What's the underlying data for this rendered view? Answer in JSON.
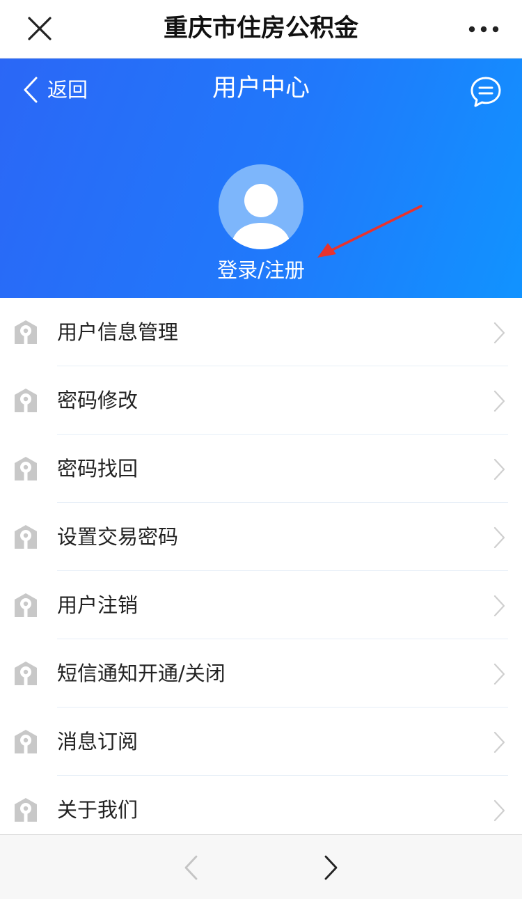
{
  "window": {
    "title": "重庆市住房公积金"
  },
  "header": {
    "back_label": "返回",
    "title": "用户中心"
  },
  "profile": {
    "login_label": "登录/注册"
  },
  "menu": {
    "items": [
      {
        "label": "用户信息管理"
      },
      {
        "label": "密码修改"
      },
      {
        "label": "密码找回"
      },
      {
        "label": "设置交易密码"
      },
      {
        "label": "用户注销"
      },
      {
        "label": "短信通知开通/关闭"
      },
      {
        "label": "消息订阅"
      },
      {
        "label": "关于我们"
      }
    ]
  },
  "colors": {
    "header_gradient_start": "#2b67f6",
    "header_gradient_end": "#1193ff",
    "avatar_bg": "#7db6fb",
    "annotation_arrow": "#e8322d",
    "menu_icon": "#c8c8c8",
    "chevron": "#cfcfcf"
  },
  "icons": {
    "close": "close-icon",
    "more": "more-dots-icon",
    "back": "chevron-left-icon",
    "message": "chat-bubble-icon",
    "avatar": "user-avatar-icon",
    "menu_item": "house-keyhole-icon",
    "menu_arrow": "chevron-right-icon",
    "nav_prev": "chevron-left-icon",
    "nav_next": "chevron-right-icon"
  }
}
